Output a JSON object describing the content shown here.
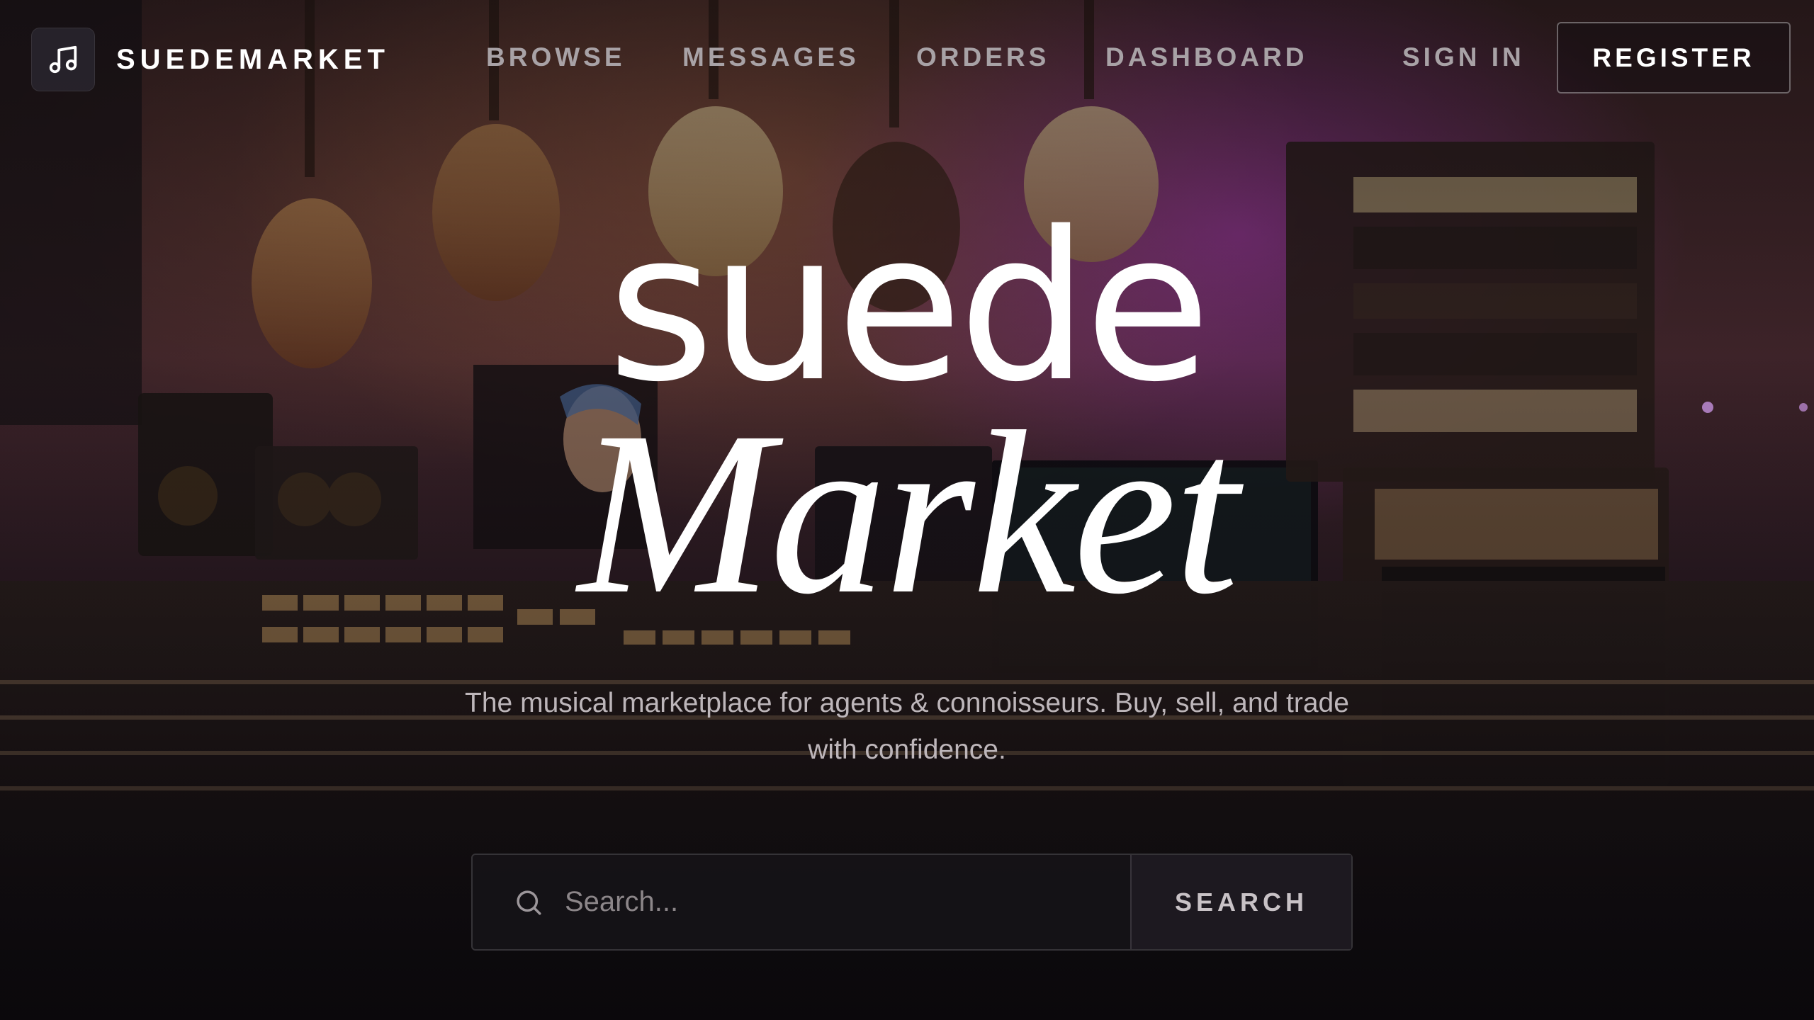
{
  "brand": {
    "name": "SUEDEMARKET",
    "icon": "music-note-icon"
  },
  "nav": {
    "links": [
      {
        "label": "BROWSE"
      },
      {
        "label": "MESSAGES"
      },
      {
        "label": "ORDERS"
      },
      {
        "label": "DASHBOARD"
      }
    ],
    "sign_in": "SIGN IN",
    "register": "REGISTER"
  },
  "hero": {
    "title_line1": "suede",
    "title_line2": "Market",
    "tagline": "The musical marketplace for agents & connoisseurs. Buy, sell, and trade with confidence."
  },
  "search": {
    "placeholder": "Search...",
    "value": "",
    "button_label": "SEARCH",
    "icon": "search-icon"
  },
  "colors": {
    "text_primary": "#ffffff",
    "text_muted": "#a8a2a6",
    "accent_glow": "#be3cd2"
  }
}
